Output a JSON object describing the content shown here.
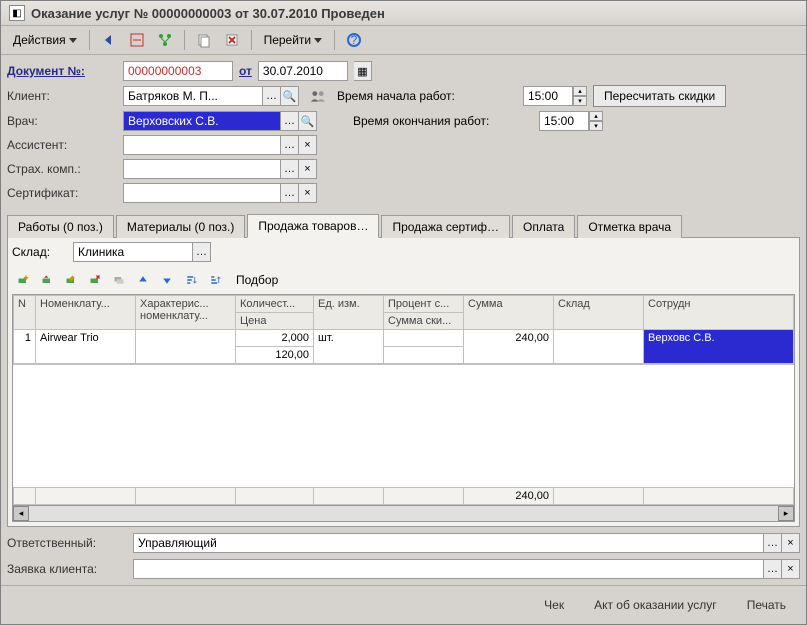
{
  "title": "Оказание услуг № 00000000003 от 30.07.2010 Проведен",
  "toolbar": {
    "actions": "Действия",
    "goto": "Перейти"
  },
  "doc": {
    "num_label": "Документ №:",
    "num": "00000000003",
    "date_label": "от",
    "date": "30.07.2010"
  },
  "fields": {
    "client_label": "Клиент:",
    "client": "Батряков М. П...",
    "doctor_label": "Врач:",
    "doctor": "Верховских С.В.",
    "assistant_label": "Ассистент:",
    "assistant": "",
    "insurance_label": "Страх. комп.:",
    "insurance": "",
    "cert_label": "Сертификат:",
    "cert": "",
    "time_start_label": "Время начала работ:",
    "time_start": "15:00",
    "time_end_label": "Время окончания работ:",
    "time_end": "15:00",
    "recalc_btn": "Пересчитать скидки"
  },
  "tabs": [
    "Работы (0 поз.)",
    "Материалы (0 поз.)",
    "Продажа товаров…",
    "Продажа сертиф…",
    "Оплата",
    "Отметка врача"
  ],
  "active_tab": 2,
  "warehouse_label": "Склад:",
  "warehouse": "Клиника",
  "select_btn": "Подбор",
  "grid": {
    "cols_top": [
      "N",
      "Номенклату...",
      "Характерис... номенклату...",
      "Количест...",
      "Ед. изм.",
      "Процент с...",
      "Сумма",
      "Склад",
      "Сотрудн"
    ],
    "cols_sub": {
      "qty": "Цена",
      "discount": "Сумма ски..."
    },
    "row": {
      "n": "1",
      "nomen": "Airwear Trio",
      "char": "",
      "qty": "2,000",
      "price": "120,00",
      "unit": "шт.",
      "discount_pct": "",
      "discount_sum": "",
      "sum": "240,00",
      "warehouse": "",
      "employee": "Верховс С.В."
    },
    "total_sum": "240,00"
  },
  "footer": {
    "responsible_label": "Ответственный:",
    "responsible": "Управляющий",
    "request_label": "Заявка клиента:",
    "request": ""
  },
  "buttons": {
    "check": "Чек",
    "act": "Акт об оказании услуг",
    "print": "Печать"
  }
}
